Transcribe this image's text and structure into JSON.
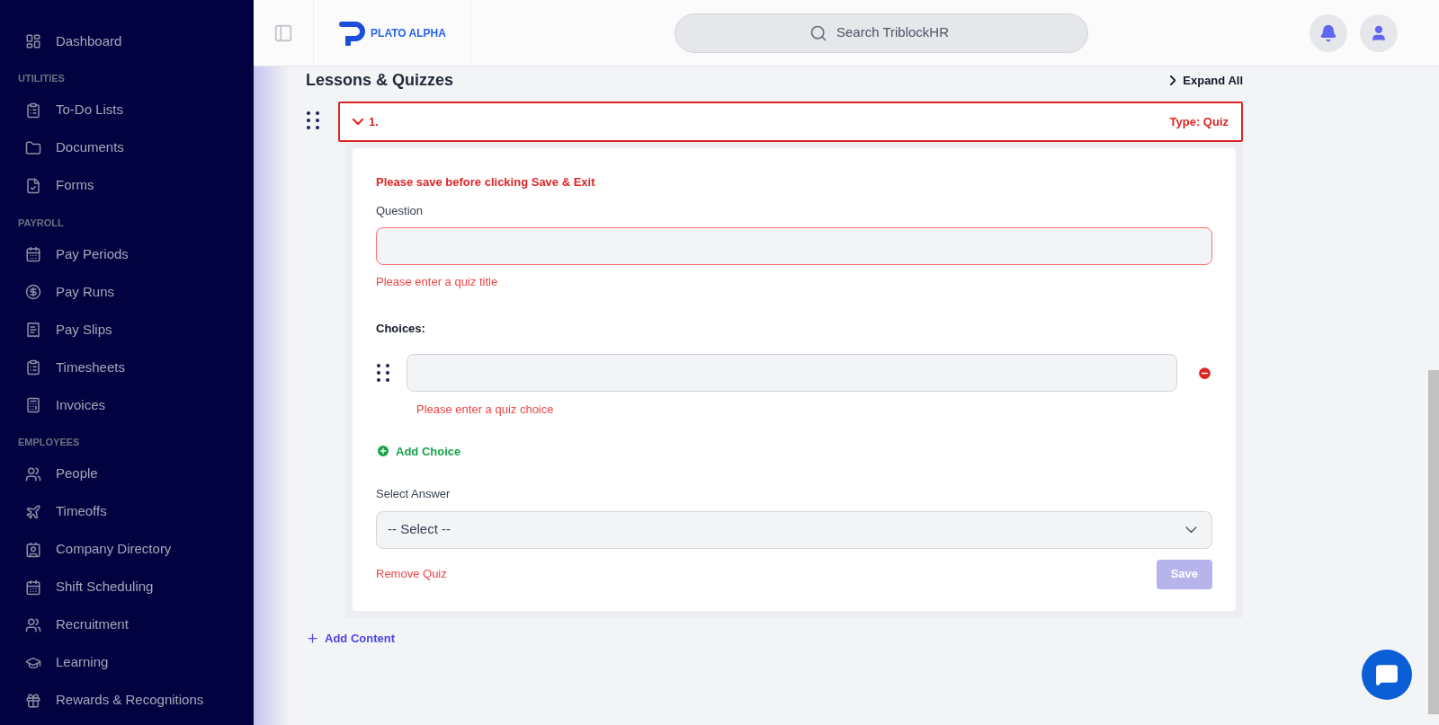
{
  "sidebar": {
    "sections": [
      {
        "items": [
          {
            "label": "Dashboard"
          }
        ]
      },
      {
        "heading": "UTILITIES",
        "items": [
          {
            "label": "To-Do Lists"
          },
          {
            "label": "Documents"
          },
          {
            "label": "Forms"
          }
        ]
      },
      {
        "heading": "PAYROLL",
        "items": [
          {
            "label": "Pay Periods"
          },
          {
            "label": "Pay Runs"
          },
          {
            "label": "Pay Slips"
          },
          {
            "label": "Timesheets"
          },
          {
            "label": "Invoices"
          }
        ]
      },
      {
        "heading": "EMPLOYEES",
        "items": [
          {
            "label": "People"
          },
          {
            "label": "Timeoffs"
          },
          {
            "label": "Company Directory"
          },
          {
            "label": "Shift Scheduling"
          },
          {
            "label": "Recruitment"
          },
          {
            "label": "Learning"
          },
          {
            "label": "Rewards & Recognitions"
          }
        ]
      }
    ]
  },
  "header": {
    "brand": "PLATO ALPHA",
    "search": {
      "placeholder": "Search TriblockHR"
    }
  },
  "content": {
    "title": "Lessons & Quizzes",
    "expand_all": "Expand All",
    "item": {
      "number": "1.",
      "type": "Type: Quiz",
      "expanded": true,
      "warning": "Please save before clicking Save & Exit",
      "question_label": "Question",
      "question_error": "Please enter a quiz title",
      "choices_label": "Choices:",
      "choices": [
        {
          "error": "Please enter a quiz choice"
        }
      ],
      "add_choice": "Add Choice",
      "answer_label": "Select Answer",
      "answer_value": "-- Select --",
      "remove": "Remove Quiz",
      "save": {
        "label": "Save",
        "disabled": true
      }
    },
    "add_content": "Add Content"
  }
}
